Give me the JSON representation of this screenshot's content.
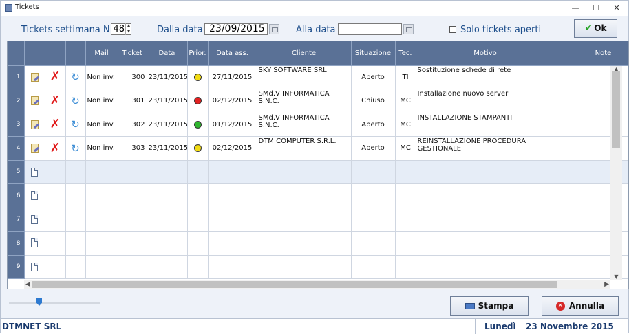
{
  "window": {
    "title": "Tickets"
  },
  "filters": {
    "week_label": "Tickets settimana N.",
    "week_value": "48",
    "from_label": "Dalla data",
    "from_value": "23/09/2015",
    "to_label": "Alla data",
    "to_value": "",
    "open_only_label": "Solo tickets aperti",
    "open_only_checked": false,
    "ok_label": "Ok"
  },
  "grid": {
    "columns": [
      "",
      "",
      "",
      "Mail",
      "Ticket",
      "Data",
      "Prior.",
      "Data ass.",
      "Cliente",
      "Situazione",
      "Tec.",
      "Motivo",
      "Note"
    ],
    "rows": [
      {
        "num": "1",
        "mail": "Non inv.",
        "ticket": "300",
        "data": "23/11/2015",
        "prio": "#f2dc14",
        "data_ass": "27/11/2015",
        "cliente": "SKY SOFTWARE SRL",
        "situazione": "Aperto",
        "tec": "TI",
        "motivo": "Sostituzione schede di rete",
        "note": ""
      },
      {
        "num": "2",
        "mail": "Non inv.",
        "ticket": "301",
        "data": "23/11/2015",
        "prio": "#e22121",
        "data_ass": "02/12/2015",
        "cliente": "SMd.V INFORMATICA S.N.C.",
        "situazione": "Chiuso",
        "tec": "MC",
        "motivo": "Installazione nuovo server",
        "note": ""
      },
      {
        "num": "3",
        "mail": "Non inv.",
        "ticket": "302",
        "data": "23/11/2015",
        "prio": "#2fb52f",
        "data_ass": "01/12/2015",
        "cliente": "SMd.V INFORMATICA S.N.C.",
        "situazione": "Aperto",
        "tec": "MC",
        "motivo": "INSTALLAZIONE STAMPANTI",
        "note": ""
      },
      {
        "num": "4",
        "mail": "Non inv.",
        "ticket": "303",
        "data": "23/11/2015",
        "prio": "#f2dc14",
        "data_ass": "02/12/2015",
        "cliente": "DTM COMPUTER S.R.L.",
        "situazione": "Aperto",
        "tec": "MC",
        "motivo": "REINSTALLAZIONE PROCEDURA GESTIONALE",
        "note": ""
      }
    ],
    "empty_rows": [
      "5",
      "6",
      "7",
      "8",
      "9"
    ]
  },
  "buttons": {
    "print_label": "Stampa",
    "cancel_label": "Annulla"
  },
  "status": {
    "company": "DTMNET SRL",
    "day": "Lunedì",
    "date": "23 Novembre  2015"
  },
  "icons": {
    "edit": "edit-icon",
    "delete": "delete-icon",
    "refresh": "refresh-icon",
    "new": "new-document-icon"
  }
}
